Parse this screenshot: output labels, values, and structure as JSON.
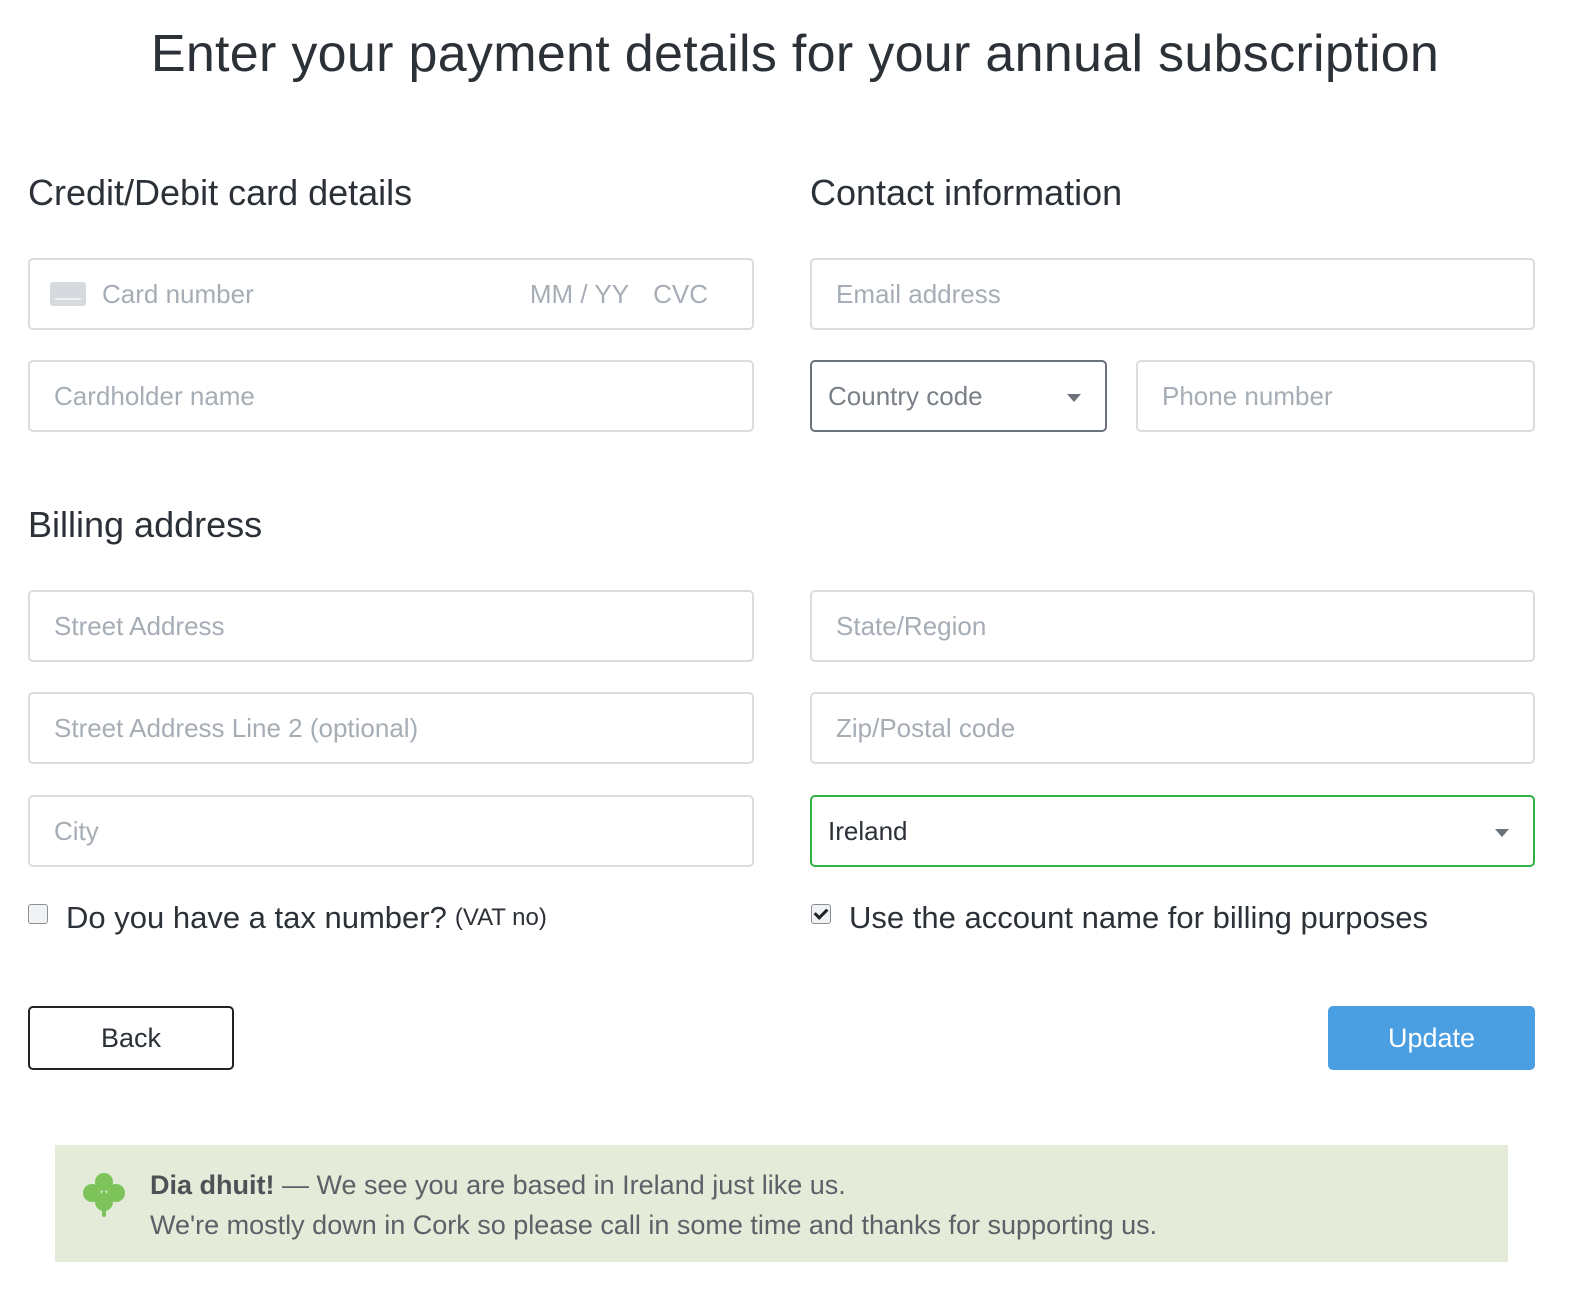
{
  "page": {
    "title": "Enter your payment details for your annual subscription"
  },
  "card_section": {
    "title": "Credit/Debit card details",
    "card_number_placeholder": "Card number",
    "expiry_placeholder": "MM / YY",
    "cvc_placeholder": "CVC",
    "cardholder_placeholder": "Cardholder name",
    "card_icon": "credit-card-icon"
  },
  "contact_section": {
    "title": "Contact information",
    "email_placeholder": "Email address",
    "country_code_value": "Country code",
    "phone_placeholder": "Phone number"
  },
  "billing_section": {
    "title": "Billing address",
    "street_placeholder": "Street Address",
    "street2_placeholder": "Street Address Line 2 (optional)",
    "city_placeholder": "City",
    "state_placeholder": "State/Region",
    "zip_placeholder": "Zip/Postal code",
    "country_value": "Ireland"
  },
  "options": {
    "tax_label": "Do you have a tax number?",
    "tax_suffix": "(VAT no)",
    "tax_checked": false,
    "account_name_label": "Use the account name for billing purposes",
    "account_name_checked": true
  },
  "actions": {
    "back_label": "Back",
    "update_label": "Update",
    "update_color": "#4a9ee2"
  },
  "notice": {
    "icon": "shamrock-icon",
    "greeting": "Dia dhuit!",
    "line1_rest": " — We see you are based in Ireland just like us.",
    "line2": "We're mostly down in Cork so please call in some time and thanks for supporting us.",
    "background_color": "#e4ebd9",
    "icon_color": "#7cc35a"
  }
}
